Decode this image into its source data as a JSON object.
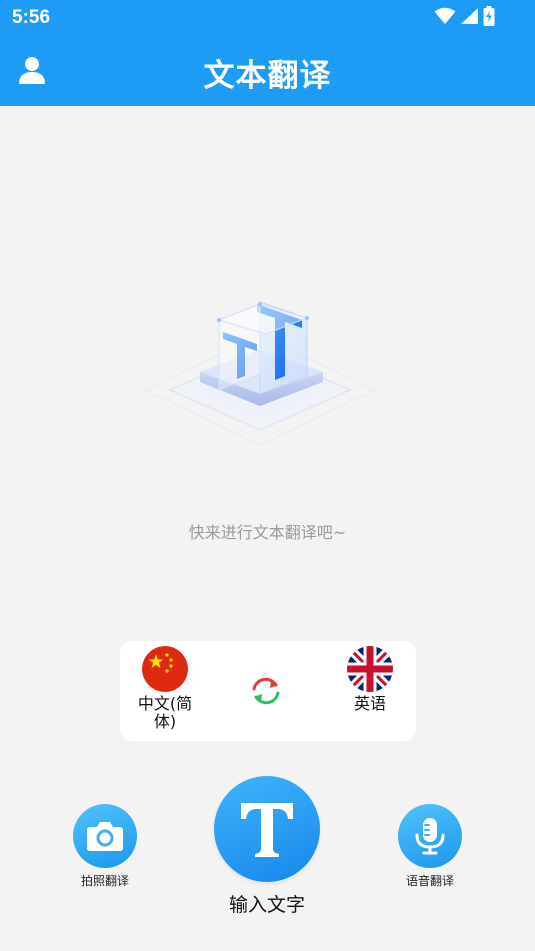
{
  "status_bar": {
    "time": "5:56",
    "icons": [
      "wifi-icon",
      "cellular-signal-icon",
      "battery-charging-icon"
    ]
  },
  "header": {
    "title": "文本翻译",
    "user_icon": "user-icon",
    "background": "#1e9bf5"
  },
  "empty_state": {
    "hint": "快来进行文本翻译吧~",
    "illustration_letter": "T"
  },
  "languages": {
    "source": {
      "label": "中文(简体)",
      "flag": "china-flag-icon"
    },
    "target": {
      "label": "英语",
      "flag": "uk-flag-icon"
    },
    "swap_icon": "swap-arrows-icon"
  },
  "actions": {
    "photo": {
      "label": "拍照翻译",
      "icon": "camera-icon"
    },
    "text": {
      "label": "输入文字",
      "glyph": "T"
    },
    "voice": {
      "label": "语音翻译",
      "icon": "microphone-icon"
    }
  },
  "colors": {
    "primary": "#1e9bf5",
    "hint_text": "#9a9a9a",
    "swap_red": "#e53935",
    "swap_green": "#2fbf5f",
    "flag_red": "#de2910",
    "flag_yellow": "#ffde00",
    "uk_blue": "#012169",
    "uk_red": "#c8102e"
  }
}
